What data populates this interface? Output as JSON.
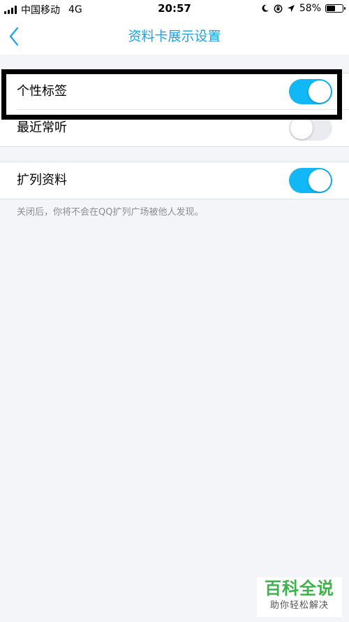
{
  "status_bar": {
    "carrier": "中国移动",
    "network": "4G",
    "time": "20:57",
    "battery_percent": "58%",
    "battery_level": 0.58
  },
  "nav": {
    "title": "资料卡展示设置"
  },
  "settings": {
    "personal_tags": {
      "label": "个性标签",
      "enabled": true
    },
    "recently_listened": {
      "label": "最近常听",
      "enabled": false
    },
    "extended_profile": {
      "label": "扩列资料",
      "enabled": true
    }
  },
  "hint": "关闭后，你将不会在QQ扩列广场被他人发现。",
  "watermark": {
    "title": "百科全说",
    "subtitle": "助你轻松解决"
  },
  "colors": {
    "accent": "#1aa3e8",
    "toggle_on": "#12b7f5",
    "toggle_off": "#e9ebef",
    "watermark_green": "#3cb34a"
  }
}
